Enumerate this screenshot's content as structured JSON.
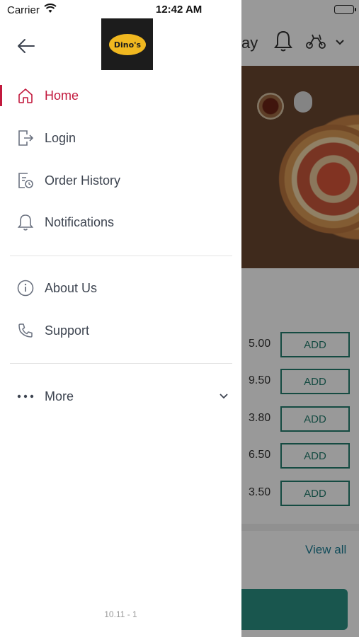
{
  "status_bar": {
    "carrier": "Carrier",
    "time": "12:42 AM"
  },
  "drawer": {
    "logo_text": "Dino's",
    "menu": [
      {
        "label": "Home",
        "icon": "home-icon",
        "active": true
      },
      {
        "label": "Login",
        "icon": "login-icon",
        "active": false
      },
      {
        "label": "Order History",
        "icon": "order-history-icon",
        "active": false
      },
      {
        "label": "Notifications",
        "icon": "bell-icon",
        "active": false
      },
      {
        "label": "About Us",
        "icon": "info-icon",
        "active": false
      },
      {
        "label": "Support",
        "icon": "phone-icon",
        "active": false
      },
      {
        "label": "More",
        "icon": "more-dots-icon",
        "active": false
      }
    ],
    "version": "10.11 - 1"
  },
  "background_app": {
    "header_text_partial": "ay",
    "products": [
      {
        "price": "5.00",
        "button": "ADD"
      },
      {
        "price": "9.50",
        "button": "ADD"
      },
      {
        "price": "3.80",
        "button": "ADD"
      },
      {
        "price": "6.50",
        "button": "ADD"
      },
      {
        "price": "3.50",
        "button": "ADD"
      }
    ],
    "view_all": "View all"
  },
  "colors": {
    "accent": "#c2193d",
    "teal": "#237e6f",
    "link": "#1f7f96",
    "text": "#3d4450"
  }
}
